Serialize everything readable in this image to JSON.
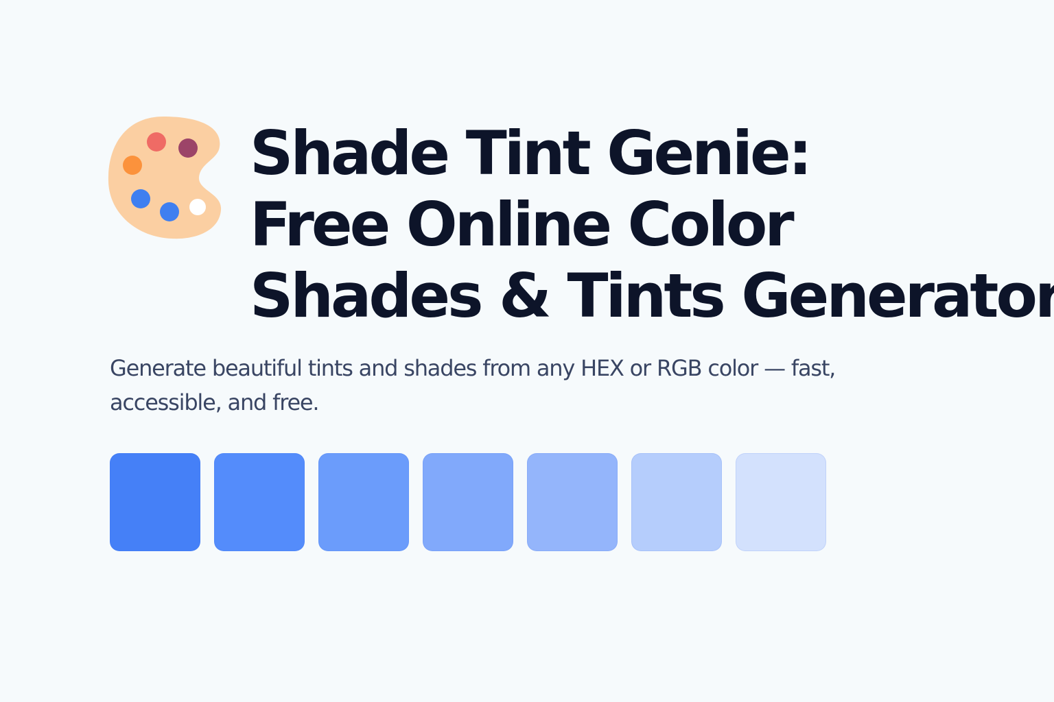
{
  "header": {
    "logo_icon": "palette-icon",
    "title_lines": [
      "Shade Tint Genie:",
      "Free Online Color",
      "Shades & Tints Generator"
    ],
    "subtitle": "Generate beautiful tints and shades from any HEX or RGB color — fast, accessible, and free."
  },
  "palette_colors": {
    "base": "#fbcfa2",
    "dots": [
      "#ef6b65",
      "#9c4468",
      "#fb923c",
      "#3f7ff0",
      "#3f7ff0",
      "#ffffff"
    ]
  },
  "swatches": [
    {
      "color": "#4580f7"
    },
    {
      "color": "#548cfb"
    },
    {
      "color": "#6b9cfb"
    },
    {
      "color": "#81a9fb"
    },
    {
      "color": "#94b5fb"
    },
    {
      "color": "#b5cdfc"
    },
    {
      "color": "#d3e1fd"
    }
  ]
}
